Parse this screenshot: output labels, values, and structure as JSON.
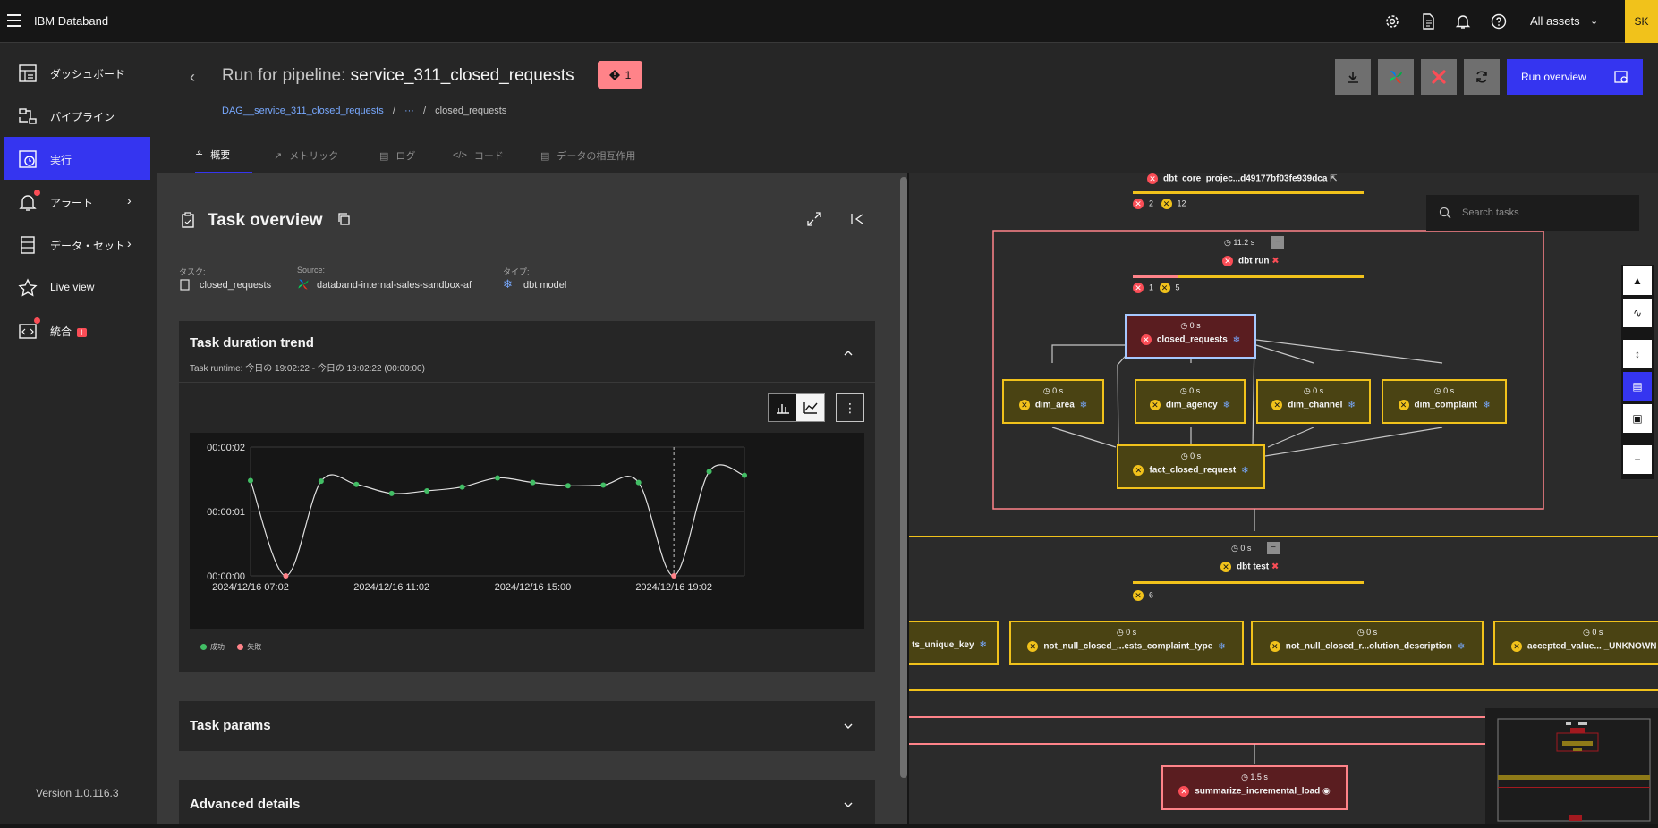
{
  "app": {
    "brand": "IBM Databand",
    "assets_label": "All assets",
    "user_initials": "SK"
  },
  "sidebar": {
    "items": [
      {
        "label": "ダッシュボード",
        "icon": "dashboard-icon"
      },
      {
        "label": "パイプライン",
        "icon": "pipeline-icon"
      },
      {
        "label": "実行",
        "icon": "runs-icon",
        "active": true
      },
      {
        "label": "アラート",
        "icon": "alert-bell-icon"
      },
      {
        "label": "データ・セット",
        "icon": "dataset-icon"
      },
      {
        "label": "Live view",
        "icon": "live-view-icon"
      },
      {
        "label": "統合",
        "icon": "integration-icon",
        "badge": "!"
      }
    ],
    "version": "Version 1.0.116.3"
  },
  "header": {
    "title_prefix": "Run for pipeline:",
    "title_name": "service_311_closed_requests",
    "alert_count": "1",
    "breadcrumb": [
      "DAG__service_311_closed_requests",
      "/",
      "···",
      "/",
      "closed_requests"
    ],
    "run_overview_label": "Run overview"
  },
  "tabs": [
    "概要",
    "メトリック",
    "ログ",
    "コード",
    "データの相互作用"
  ],
  "overview": {
    "title": "Task overview",
    "task_label": "タスク:",
    "task_value": "closed_requests",
    "source_label": "Source:",
    "source_value": "databand-internal-sales-sandbox-af",
    "type_label": "タイプ:",
    "type_value": "dbt model"
  },
  "trend": {
    "title": "Task duration trend",
    "runtime": "Task runtime: 今日の 19:02:22 - 今日の 19:02:22 (00:00:00)",
    "legend_success": "成功",
    "legend_fail": "失敗"
  },
  "params_title": "Task params",
  "advanced_title": "Advanced details",
  "chart_data": {
    "type": "line",
    "y_ticks": [
      "00:00:02",
      "00:00:01",
      "00:00:00"
    ],
    "x_ticks": [
      "2024/12/16 07:02",
      "2024/12/16 11:02",
      "2024/12/16 15:00",
      "2024/12/16 19:02"
    ],
    "ylim": [
      0,
      2
    ],
    "series": [
      {
        "name": "成功",
        "status_colors": {
          "success": "#42be65",
          "fail": "#ff8389"
        },
        "x": [
          0,
          1,
          2,
          3,
          4,
          5,
          6,
          7,
          8,
          9,
          10,
          11,
          12,
          13,
          14
        ],
        "values": [
          1.48,
          0.0,
          1.47,
          1.42,
          1.28,
          1.32,
          1.38,
          1.52,
          1.45,
          1.4,
          1.41,
          1.45,
          0.0,
          1.62,
          1.56
        ],
        "status": [
          "success",
          "fail",
          "success",
          "success",
          "success",
          "success",
          "success",
          "success",
          "success",
          "success",
          "success",
          "success",
          "fail",
          "success",
          "success"
        ]
      }
    ]
  },
  "dag": {
    "search_placeholder": "Search tasks",
    "project": {
      "name": "dbt_core_projec...d49177bf03fe939dca",
      "errors": "2",
      "warnings": "12"
    },
    "dbt_run": {
      "time": "11.2 s",
      "name": "dbt run",
      "errors": "1",
      "warnings": "5"
    },
    "closed_requests": {
      "time": "0 s",
      "name": "closed_requests"
    },
    "models": [
      {
        "time": "0 s",
        "name": "dim_area"
      },
      {
        "time": "0 s",
        "name": "dim_agency"
      },
      {
        "time": "0 s",
        "name": "dim_channel"
      },
      {
        "time": "0 s",
        "name": "dim_complaint"
      }
    ],
    "fact": {
      "time": "0 s",
      "name": "fact_closed_request"
    },
    "dbt_test": {
      "time": "0 s",
      "name": "dbt test",
      "warnings": "6"
    },
    "tests": [
      {
        "time": "",
        "name": "ts_unique_key"
      },
      {
        "time": "0 s",
        "name": "not_null_closed_...ests_complaint_type"
      },
      {
        "time": "0 s",
        "name": "not_null_closed_r...olution_description"
      },
      {
        "time": "0 s",
        "name": "accepted_value... _UNKNOWN"
      }
    ],
    "summarize": {
      "time": "1.5 s",
      "name": "summarize_incremental_load"
    }
  }
}
